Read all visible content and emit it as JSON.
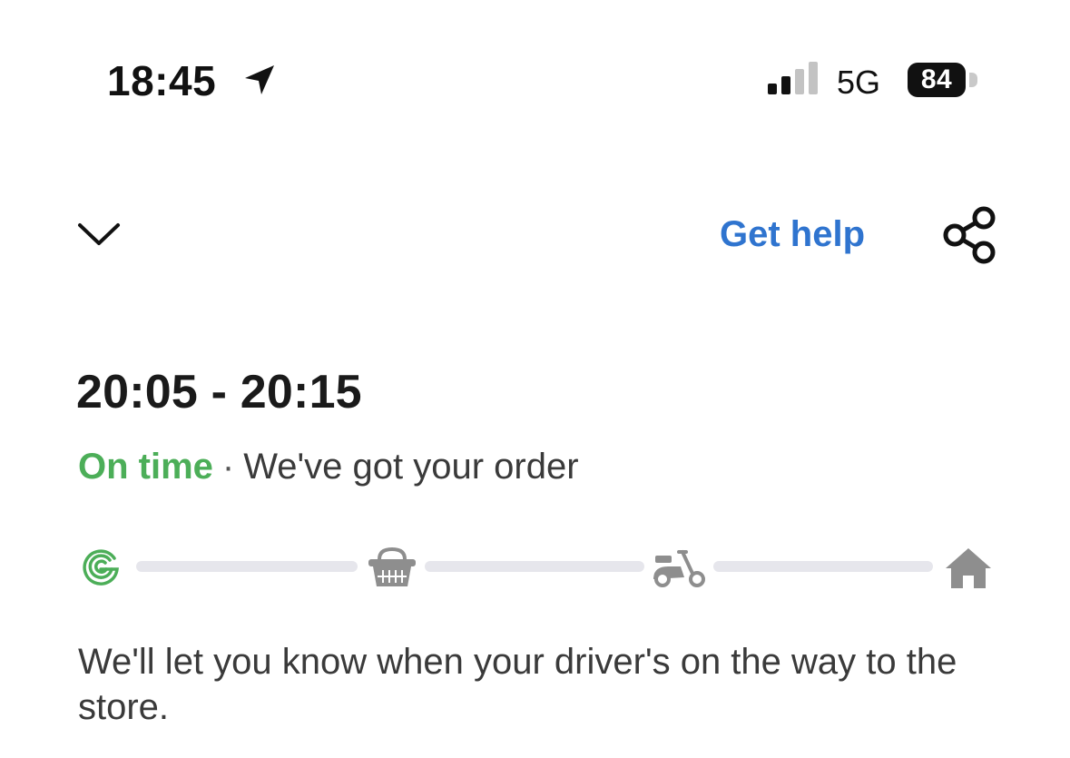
{
  "status_bar": {
    "time": "18:45",
    "network": "5G",
    "battery": "84",
    "icons": [
      "location-arrow-icon",
      "signal-icon",
      "battery-icon"
    ]
  },
  "header": {
    "collapse_icon": "chevron-down-icon",
    "get_help_label": "Get help",
    "share_icon": "share-icon"
  },
  "order": {
    "eta": "20:05 - 20:15",
    "timeliness": "On time",
    "separator": "·",
    "status": "We've got your order",
    "progress": {
      "steps": [
        {
          "name": "order-received",
          "icon": "g-logo-icon",
          "active": true
        },
        {
          "name": "shopping",
          "icon": "basket-icon",
          "active": false
        },
        {
          "name": "on-the-way",
          "icon": "scooter-icon",
          "active": false
        },
        {
          "name": "delivered",
          "icon": "home-icon",
          "active": false
        }
      ]
    },
    "info": "We'll let you know when your driver's on the way to the store."
  },
  "colors": {
    "link": "#2f74cf",
    "on_time": "#4cae58",
    "inactive_icon": "#8e8e8e",
    "track": "#e6e6ec"
  }
}
